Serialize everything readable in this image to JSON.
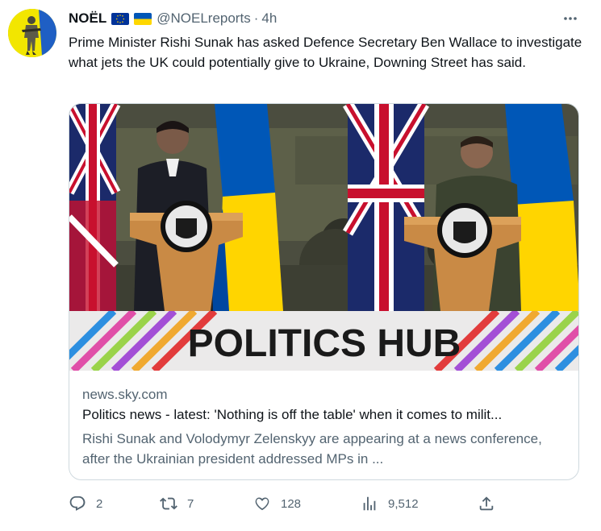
{
  "author": {
    "display_name": "NOËL",
    "flags": [
      "eu-flag-icon",
      "ukraine-flag-icon"
    ],
    "handle": "@NOELreports",
    "separator": "·",
    "time": "4h"
  },
  "tweet": {
    "text": "Prime Minister Rishi Sunak has asked Defence Secretary Ben Wallace to investigate what jets the UK could potentially give to Ukraine, Downing Street has said."
  },
  "card": {
    "banner_text": "POLITICS HUB",
    "domain": "news.sky.com",
    "title": "Politics news - latest: 'Nothing is off the table' when it comes to milit...",
    "description": "Rishi Sunak and Volodymyr Zelenskyy are appearing at a news conference, after the Ukrainian president addressed MPs in ..."
  },
  "actions": {
    "replies": "2",
    "retweets": "7",
    "likes": "128",
    "views": "9,512"
  },
  "colors": {
    "text": "#0f1419",
    "secondary": "#536471",
    "border": "#cfd9de",
    "avatar_bg": "#f2e600",
    "eu_blue": "#003399",
    "ua_blue": "#0057b7",
    "ua_yellow": "#ffd700"
  }
}
